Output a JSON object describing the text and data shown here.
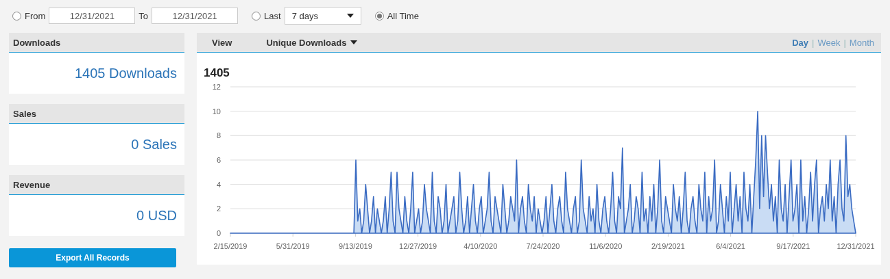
{
  "filter": {
    "options": [
      {
        "kind": "range",
        "label": "From",
        "selected": false,
        "from": "12/31/2021",
        "to_label": "To",
        "to": "12/31/2021"
      },
      {
        "kind": "last",
        "label": "Last",
        "selected": false,
        "value": "7 days"
      },
      {
        "kind": "all",
        "label": "All Time",
        "selected": true
      }
    ]
  },
  "stats": [
    {
      "title": "Downloads",
      "value": "1405 Downloads"
    },
    {
      "title": "Sales",
      "value": "0 Sales"
    },
    {
      "title": "Revenue",
      "value": "0 USD"
    }
  ],
  "export_button": "Export All Records",
  "chart_panel": {
    "view_label": "View",
    "metric": "Unique Downloads",
    "periods": [
      {
        "label": "Day",
        "selected": true
      },
      {
        "label": "Week",
        "selected": false
      },
      {
        "label": "Month",
        "selected": false
      }
    ],
    "separators": [
      "|",
      "|"
    ],
    "total": "1405",
    "x_axis_labels": [
      "2/15/2019",
      "5/31/2019",
      "9/13/2019",
      "12/27/2019",
      "4/10/2020",
      "7/24/2020",
      "11/6/2020",
      "2/19/2021",
      "6/4/2021",
      "9/17/2021",
      "12/31/2021"
    ],
    "chart_data": {
      "type": "area",
      "ylim": [
        0,
        12
      ],
      "yticks": [
        0,
        2,
        4,
        6,
        8,
        10,
        12
      ],
      "grid": true,
      "series": [
        {
          "color": "#3a6bc2",
          "values": [
            0,
            0,
            0,
            0,
            0,
            0,
            0,
            0,
            0,
            0,
            0,
            0,
            0,
            0,
            0,
            0,
            0,
            0,
            0,
            0,
            0,
            0,
            0,
            0,
            0,
            0,
            0,
            0,
            0,
            0,
            0,
            0,
            0,
            0,
            0,
            0,
            0,
            0,
            0,
            0,
            0,
            0,
            0,
            0,
            0,
            0,
            0,
            0,
            0,
            0,
            0,
            0,
            0,
            0,
            0,
            0,
            0,
            0,
            0,
            0,
            0,
            0,
            0,
            0,
            6,
            1,
            2,
            0,
            1,
            4,
            2,
            0,
            1,
            3,
            0,
            2,
            1,
            0,
            1,
            3,
            0,
            2,
            5,
            1,
            0,
            5,
            2,
            1,
            0,
            3,
            1,
            0,
            2,
            5,
            0,
            1,
            2,
            0,
            1,
            4,
            2,
            1,
            0,
            5,
            1,
            0,
            3,
            2,
            0,
            1,
            4,
            0,
            1,
            2,
            3,
            0,
            1,
            5,
            2,
            0,
            1,
            3,
            0,
            2,
            4,
            1,
            0,
            2,
            3,
            0,
            1,
            2,
            5,
            1,
            0,
            3,
            2,
            1,
            0,
            4,
            2,
            0,
            1,
            3,
            2,
            1,
            6,
            0,
            2,
            3,
            1,
            0,
            4,
            2,
            1,
            3,
            0,
            2,
            1,
            0,
            1,
            3,
            0,
            2,
            4,
            1,
            0,
            2,
            3,
            1,
            0,
            5,
            2,
            1,
            0,
            2,
            3,
            0,
            1,
            6,
            2,
            1,
            0,
            3,
            1,
            2,
            0,
            4,
            1,
            0,
            2,
            3,
            1,
            0,
            2,
            5,
            1,
            0,
            3,
            2,
            7,
            0,
            1,
            2,
            4,
            0,
            1,
            3,
            2,
            0,
            5,
            1,
            2,
            0,
            3,
            1,
            4,
            0,
            2,
            6,
            1,
            0,
            3,
            2,
            1,
            0,
            4,
            2,
            1,
            3,
            0,
            2,
            5,
            1,
            0,
            2,
            3,
            1,
            0,
            4,
            2,
            1,
            5,
            0,
            3,
            1,
            2,
            6,
            0,
            1,
            4,
            2,
            0,
            3,
            1,
            5,
            0,
            2,
            4,
            1,
            3,
            0,
            5,
            2,
            1,
            4,
            0,
            3,
            6,
            10,
            2,
            8,
            3,
            8,
            5,
            2,
            4,
            1,
            3,
            0,
            6,
            2,
            1,
            4,
            0,
            3,
            6,
            1,
            2,
            4,
            0,
            6,
            1,
            3,
            0,
            2,
            5,
            1,
            4,
            6,
            0,
            2,
            3,
            1,
            4,
            2,
            6,
            1,
            3,
            0,
            4,
            6,
            2,
            1,
            8,
            3,
            4,
            2,
            1,
            0
          ]
        }
      ]
    }
  }
}
